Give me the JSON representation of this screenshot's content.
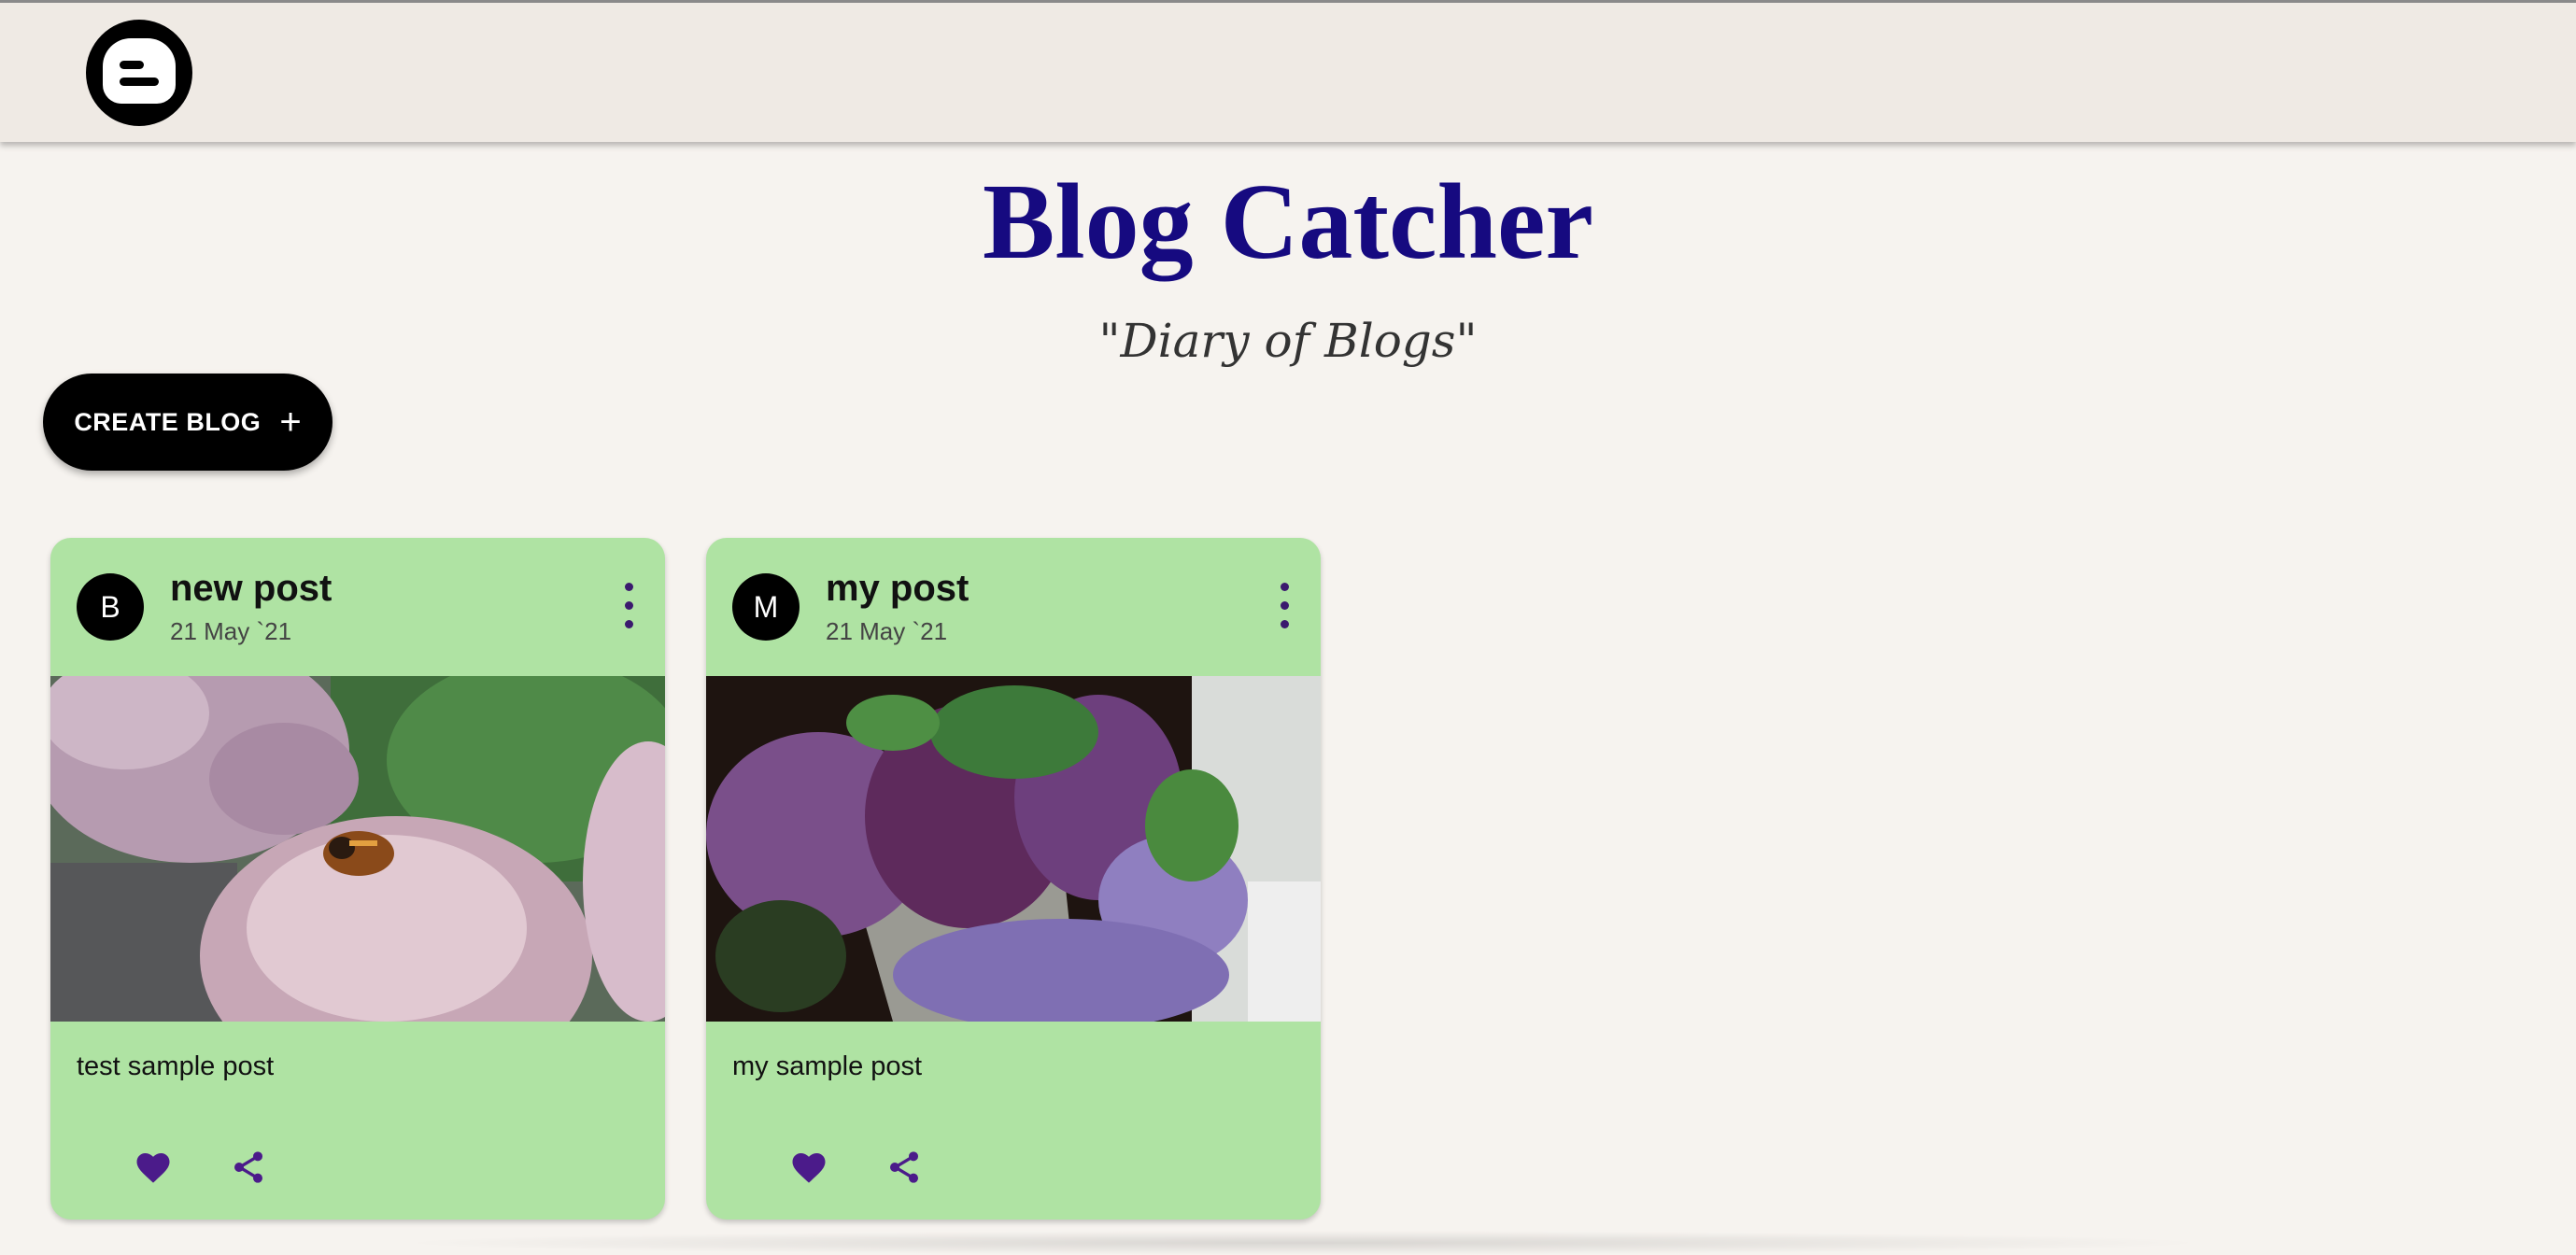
{
  "header": {
    "logo_icon": "blogger-logo-icon"
  },
  "site": {
    "title": "Blog Catcher",
    "tagline": "\"Diary of Blogs\""
  },
  "create_button": {
    "label": "CREATE BLOG",
    "icon": "plus-icon"
  },
  "colors": {
    "title": "#160a80",
    "card_bg": "#afe3a3",
    "action_icons": "#4b1b8a",
    "button_bg": "#000000"
  },
  "posts": [
    {
      "avatar": "B",
      "title": "new post",
      "date": "21 May `21",
      "text": "test sample post",
      "image": "pink sedum flowers with a bee"
    },
    {
      "avatar": "M",
      "title": "my post",
      "date": "21 May `21",
      "text": "my sample post",
      "image": "purple lilac bouquet in a vase"
    }
  ]
}
